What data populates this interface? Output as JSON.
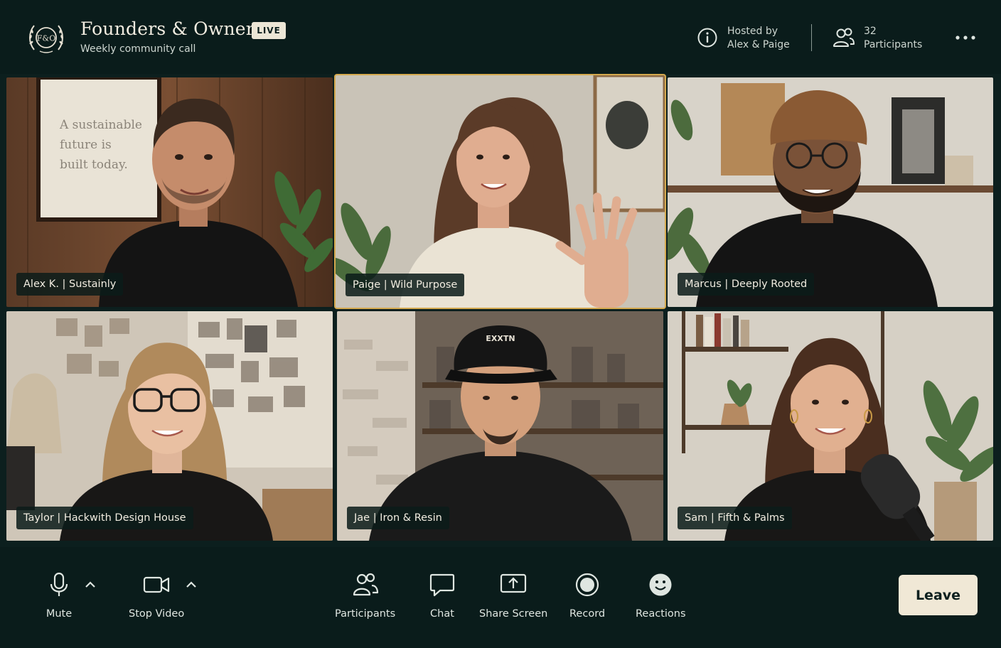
{
  "header": {
    "logo_icon": "founders-owners-crest-logo",
    "logo_text": "F&O",
    "title": "Founders & Owners",
    "live_badge": "LIVE",
    "subtitle": "Weekly community call",
    "hosted_by_label": "Hosted by",
    "hosts": "Alex & Paige",
    "participants_count": "32",
    "participants_label": "Participants",
    "more_icon": "more-horizontal-icon"
  },
  "tiles": [
    {
      "name": "Alex K. | Sustainly",
      "active": false,
      "wall_text": [
        "A sustainable",
        "future is",
        "built today."
      ]
    },
    {
      "name": "Paige | Wild Purpose",
      "active": true
    },
    {
      "name": "Marcus | Deeply Rooted",
      "active": false
    },
    {
      "name": "Taylor | Hackwith Design House",
      "active": false
    },
    {
      "name": "Jae | Iron & Resin",
      "active": false,
      "cap_text": "EXXTN"
    },
    {
      "name": "Sam | Fifth & Palms",
      "active": false
    }
  ],
  "toolbar": {
    "mute": {
      "label": "Mute",
      "icon": "microphone-icon"
    },
    "stop_video": {
      "label": "Stop Video",
      "icon": "video-camera-icon"
    },
    "participants": {
      "label": "Participants",
      "icon": "people-icon"
    },
    "chat": {
      "label": "Chat",
      "icon": "chat-bubble-icon"
    },
    "share_screen": {
      "label": "Share Screen",
      "icon": "share-screen-icon"
    },
    "record": {
      "label": "Record",
      "icon": "record-icon"
    },
    "reactions": {
      "label": "Reactions",
      "icon": "smiley-icon"
    },
    "leave": {
      "label": "Leave"
    }
  },
  "colors": {
    "background": "#0c1f1e",
    "active_speaker_border": "#d4a94e",
    "leave_button": "#f0e8d6"
  }
}
